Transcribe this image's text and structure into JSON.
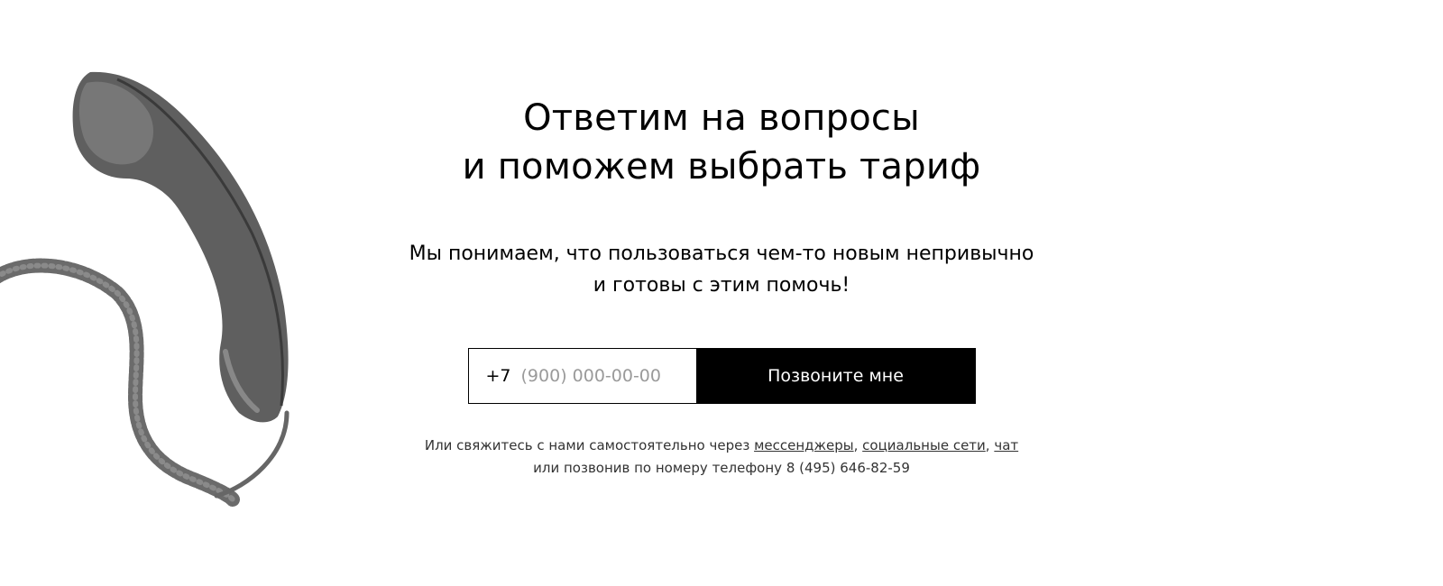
{
  "heading": {
    "line1": "Ответим на вопросы",
    "line2": "и поможем выбрать тариф"
  },
  "subheading": {
    "line1": "Мы понимаем, что пользоваться чем-то новым непривычно",
    "line2": "и готовы с этим помочь!"
  },
  "callback_form": {
    "country_code": "+7",
    "phone_placeholder": "(900) 000-00-00",
    "phone_value": "",
    "submit_label": "Позвоните мне"
  },
  "contacts": {
    "intro": "Или свяжитесь с нами самостоятельно через ",
    "link_messengers": "мессенджеры",
    "sep1": ", ",
    "link_social": "социальные сети",
    "sep2": ", ",
    "link_chat": "чат",
    "phone_intro": "или позвонив по номеру телефону ",
    "phone_number": "8 (495) 646-82-59"
  },
  "illustration": {
    "icon": "telephone-handset-icon",
    "color": "#5a5a5a"
  }
}
